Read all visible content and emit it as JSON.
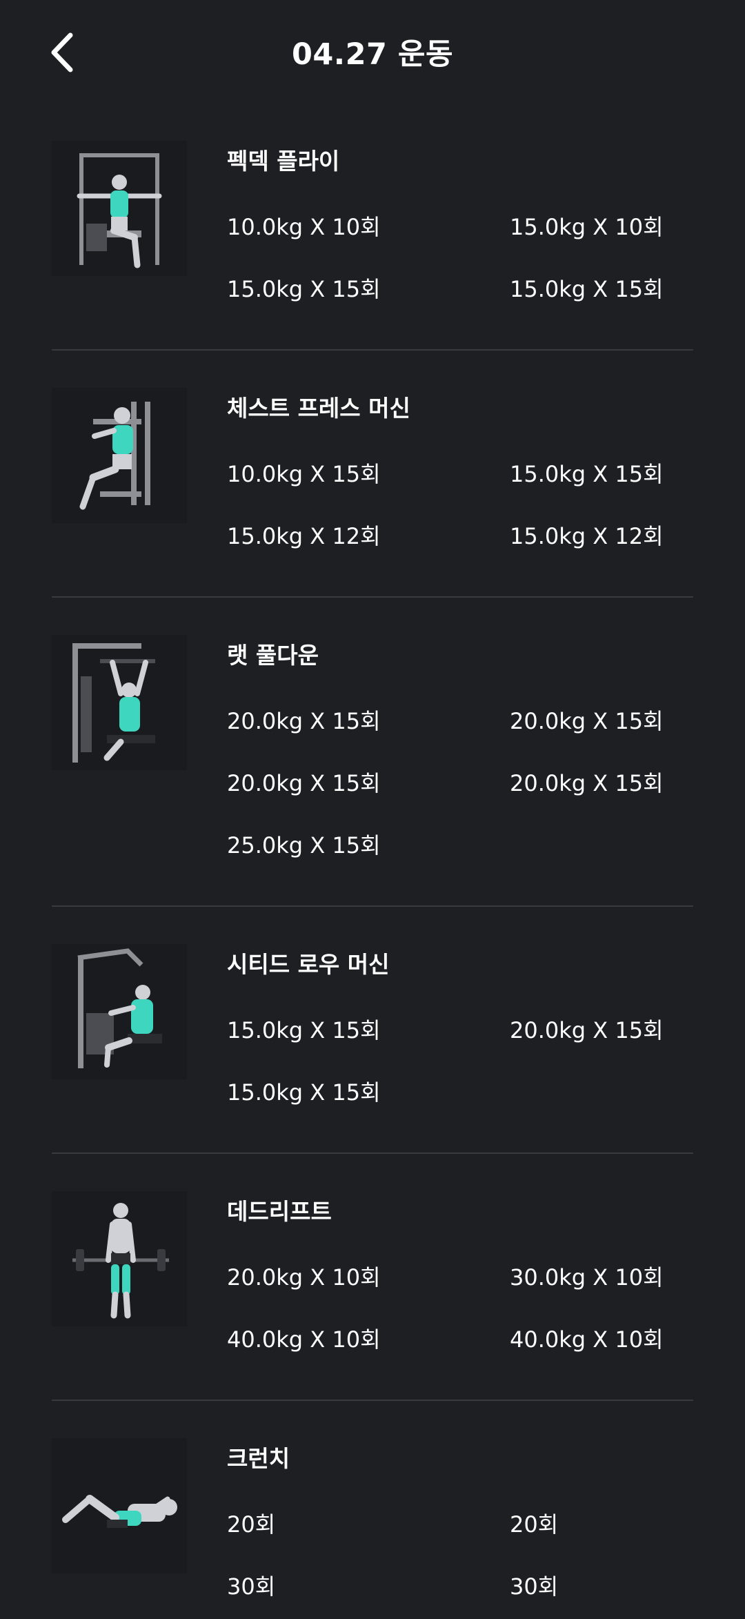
{
  "header": {
    "title": "04.27 운동",
    "back_icon": "chevron-left-icon"
  },
  "colors": {
    "background": "#1e1f23",
    "divider": "#393a3f",
    "muscle_highlight": "#3fd6c0",
    "text": "#ffffff"
  },
  "exercises": [
    {
      "name": "펙덱 플라이",
      "image": "pec-deck-fly-illustration",
      "sets": [
        "10.0kg X 10회",
        "15.0kg X 10회",
        "15.0kg X 15회",
        "15.0kg X 15회"
      ]
    },
    {
      "name": "체스트 프레스 머신",
      "image": "chest-press-machine-illustration",
      "sets": [
        "10.0kg X 15회",
        "15.0kg X 15회",
        "15.0kg X 12회",
        "15.0kg X 12회"
      ]
    },
    {
      "name": "랫 풀다운",
      "image": "lat-pulldown-illustration",
      "sets": [
        "20.0kg X 15회",
        "20.0kg X 15회",
        "20.0kg X 15회",
        "20.0kg X 15회",
        "25.0kg X 15회"
      ]
    },
    {
      "name": "시티드 로우 머신",
      "image": "seated-row-machine-illustration",
      "sets": [
        "15.0kg X 15회",
        "20.0kg X 15회",
        "15.0kg X 15회"
      ]
    },
    {
      "name": "데드리프트",
      "image": "deadlift-illustration",
      "sets": [
        "20.0kg X 10회",
        "30.0kg X 10회",
        "40.0kg X 10회",
        "40.0kg X 10회"
      ]
    },
    {
      "name": "크런치",
      "image": "crunch-illustration",
      "sets": [
        "20회",
        "20회",
        "30회",
        "30회"
      ]
    }
  ]
}
